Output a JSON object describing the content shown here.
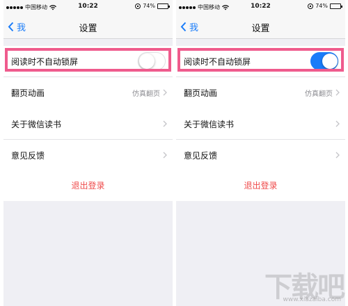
{
  "statusbar": {
    "carrier": "中国移动",
    "time": "10:22",
    "battery": "74%",
    "battery_level": 0.74
  },
  "navbar": {
    "back_label": "我",
    "title": "设置"
  },
  "settings": {
    "no_autolock_label": "阅读时不自动锁屏",
    "page_anim_label": "翻页动画",
    "page_anim_value": "仿真翻页",
    "about_label": "关于微信读书",
    "feedback_label": "意见反馈",
    "logout_label": "退出登录"
  },
  "screens": [
    {
      "toggle_state": "off"
    },
    {
      "toggle_state": "on"
    }
  ],
  "colors": {
    "accent": "#1a7cf9",
    "highlight": "#ef5b8d",
    "logout": "#ef4b4b",
    "background": "#efeff4"
  },
  "watermark": {
    "text": "下载吧",
    "url": "www.xiazaiba.com"
  }
}
